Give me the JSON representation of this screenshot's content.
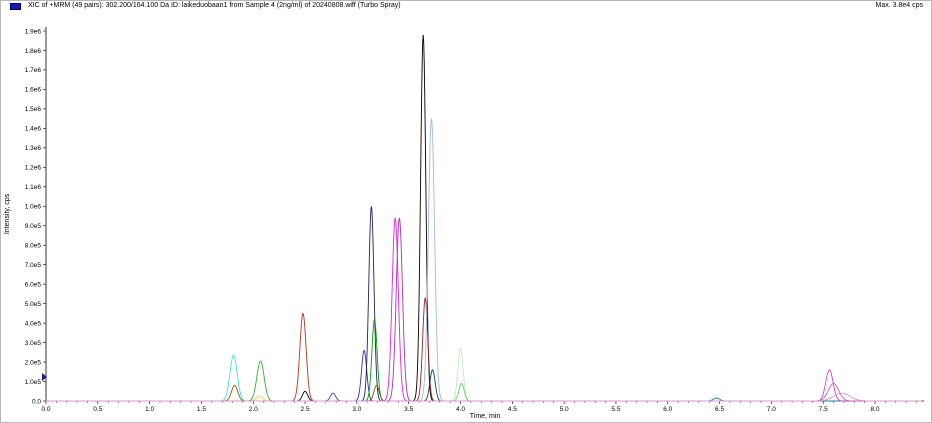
{
  "window": {
    "title": "XIC of +MRM (49 pairs): 302.200/164.100 Da ID: laikeduobaan1 from Sample 4 (2ng/ml) of 20240808.wiff (Turbo Spray)",
    "max_label": "Max. 3.8e4 cps"
  },
  "colors": {
    "legend_swatch": "#1a1aa0",
    "axis": "#000000",
    "marker": "#1a1aa0"
  },
  "chart_data": {
    "type": "line",
    "title": "XIC of +MRM (49 pairs): 302.200/164.100 Da ID: laikeduobaan1 from Sample 4 (2ng/ml) of 20240808.wiff (Turbo Spray)",
    "xlabel": "Time, min",
    "ylabel": "Intensity, cps",
    "xlim": [
      0,
      8.5
    ],
    "ylim": [
      0,
      1900000.0
    ],
    "grid": false,
    "x_ticks": [
      "0.0",
      "0.5",
      "1.0",
      "1.5",
      "2.0",
      "2.5",
      "3.0",
      "3.5",
      "4.0",
      "4.5",
      "5.0",
      "5.5",
      "6.0",
      "6.5",
      "7.0",
      "7.5",
      "8.0"
    ],
    "y_ticks": [
      "0.0",
      "1.0e5",
      "2.0e5",
      "3.0e5",
      "4.0e5",
      "5.0e5",
      "6.0e5",
      "7.0e5",
      "8.0e5",
      "9.0e5",
      "1.0e6",
      "1.1e6",
      "1.2e6",
      "1.3e6",
      "1.4e6",
      "1.5e6",
      "1.6e6",
      "1.7e6",
      "1.8e6",
      "1.9e6"
    ],
    "y_tick_values": [
      0,
      100000,
      200000,
      300000,
      400000,
      500000,
      600000,
      700000,
      800000,
      900000,
      1000000,
      1100000,
      1200000,
      1300000,
      1400000,
      1500000,
      1600000,
      1700000,
      1800000,
      1900000
    ],
    "peaks": [
      {
        "color": "#40e0e0",
        "rt": 1.81,
        "height": 235000,
        "width": 0.035
      },
      {
        "color": "#806000",
        "rt": 1.82,
        "height": 80000,
        "width": 0.03
      },
      {
        "color": "#30b030",
        "rt": 2.07,
        "height": 205000,
        "width": 0.035
      },
      {
        "color": "#e0e040",
        "rt": 2.06,
        "height": 25000,
        "width": 0.03
      },
      {
        "color": "#c03020",
        "rt": 2.48,
        "height": 450000,
        "width": 0.03
      },
      {
        "color": "#000000",
        "rt": 2.5,
        "height": 50000,
        "width": 0.025
      },
      {
        "color": "#4040a0",
        "rt": 2.77,
        "height": 40000,
        "width": 0.025
      },
      {
        "color": "#3030c0",
        "rt": 3.07,
        "height": 260000,
        "width": 0.025
      },
      {
        "color": "#202060",
        "rt": 3.14,
        "height": 1000000,
        "width": 0.025
      },
      {
        "color": "#00a000",
        "rt": 3.17,
        "height": 420000,
        "width": 0.025
      },
      {
        "color": "#606000",
        "rt": 3.19,
        "height": 80000,
        "width": 0.025
      },
      {
        "color": "#e020e0",
        "rt": 3.37,
        "height": 940000,
        "width": 0.03
      },
      {
        "color": "#b030b0",
        "rt": 3.41,
        "height": 940000,
        "width": 0.03
      },
      {
        "color": "#000000",
        "rt": 3.64,
        "height": 1880000,
        "width": 0.025
      },
      {
        "color": "#a02020",
        "rt": 3.66,
        "height": 530000,
        "width": 0.025
      },
      {
        "color": "#a0b8e0",
        "rt": 3.72,
        "height": 1450000,
        "width": 0.03
      },
      {
        "color": "#104060",
        "rt": 3.73,
        "height": 160000,
        "width": 0.025
      },
      {
        "color": "#c0e8c0",
        "rt": 4.0,
        "height": 270000,
        "width": 0.025
      },
      {
        "color": "#60d060",
        "rt": 4.01,
        "height": 90000,
        "width": 0.025
      },
      {
        "color": "#2080a0",
        "rt": 6.47,
        "height": 15000,
        "width": 0.03
      },
      {
        "color": "#e040c0",
        "rt": 7.56,
        "height": 160000,
        "width": 0.035
      },
      {
        "color": "#c060c0",
        "rt": 7.6,
        "height": 90000,
        "width": 0.05
      },
      {
        "color": "#e090d0",
        "rt": 7.68,
        "height": 40000,
        "width": 0.08
      }
    ],
    "annotations": []
  }
}
